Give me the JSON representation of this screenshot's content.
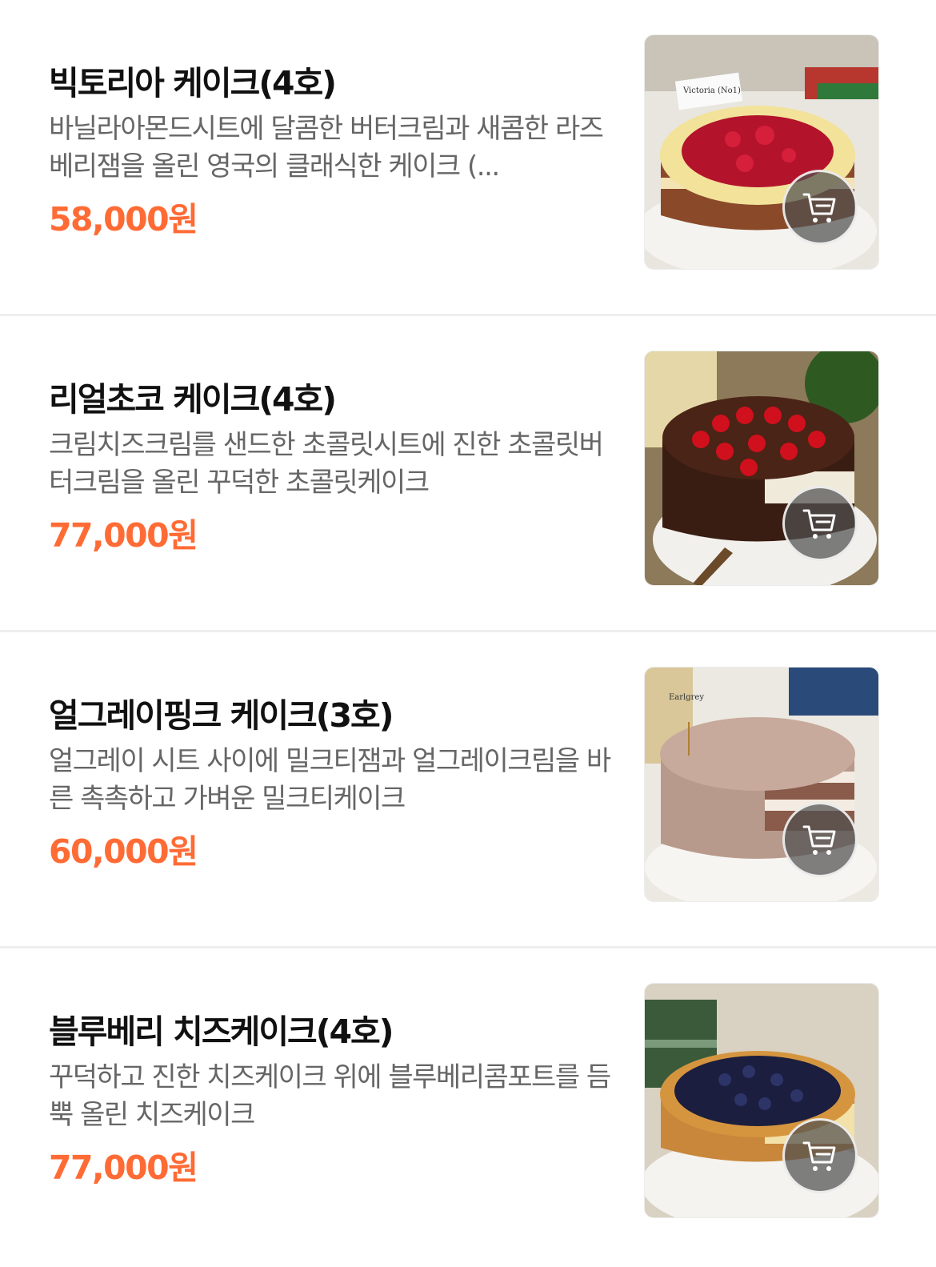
{
  "products": [
    {
      "name": "빅토리아 케이크(4호)",
      "description": "바닐라아몬드시트에 달콤한 버터크림과 새콤한 라즈베리잼을 올린 영국의 클래식한 케이크 (...",
      "price": "58,000원"
    },
    {
      "name": "리얼초코 케이크(4호)",
      "description": "크림치즈크림를 샌드한 초콜릿시트에 진한 초콜릿버터크림을 올린 꾸덕한 초콜릿케이크",
      "price": "77,000원"
    },
    {
      "name": "얼그레이핑크 케이크(3호)",
      "description": "얼그레이 시트 사이에 밀크티잼과 얼그레이크림을 바른 촉촉하고 가벼운 밀크티케이크",
      "price": "60,000원"
    },
    {
      "name": "블루베리 치즈케이크(4호)",
      "description": "꾸덕하고 진한 치즈케이크 위에 블루베리콤포트를 듬뿍 올린 치즈케이크",
      "price": "77,000원"
    }
  ],
  "colors": {
    "price": "#ff6b35",
    "divider": "#eeeeee",
    "description": "#666666"
  },
  "icons": {
    "cart_button": "shopping-cart-icon"
  }
}
